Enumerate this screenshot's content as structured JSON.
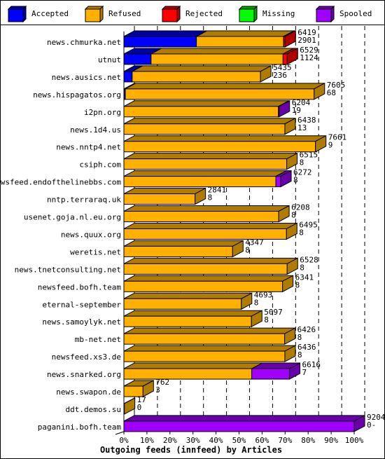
{
  "chart_data": {
    "type": "bar",
    "orientation": "horizontal",
    "stacked": true,
    "style": "3d",
    "title": "Outgoing feeds (innfeed) by Articles",
    "xlabel": "Outgoing feeds (innfeed) by Articles",
    "ylabel": "",
    "xlim": [
      0,
      100
    ],
    "x_ticks": [
      "0%",
      "10%",
      "20%",
      "30%",
      "40%",
      "50%",
      "60%",
      "70%",
      "80%",
      "90%",
      "100%"
    ],
    "grid": true,
    "legend_position": "top",
    "legend": [
      {
        "name": "Accepted",
        "color": "#0000ff",
        "side": "#0000a0"
      },
      {
        "name": "Refused",
        "color": "#ffb000",
        "side": "#b07c00"
      },
      {
        "name": "Rejected",
        "color": "#ff0000",
        "side": "#b00000"
      },
      {
        "name": "Missing",
        "color": "#00ff00",
        "side": "#00a000"
      },
      {
        "name": "Spooled",
        "color": "#a000ff",
        "side": "#6a00aa"
      }
    ],
    "categories": [
      "news.chmurka.net",
      "utnut",
      "news.ausics.net",
      "news.hispagatos.org",
      "i2pn.org",
      "news.1d4.us",
      "news.nntp4.net",
      "csiph.com",
      "newsfeed.endofthelinebbs.com",
      "nntp.terraraq.uk",
      "usenet.goja.nl.eu.org",
      "news.quux.org",
      "weretis.net",
      "news.tnetconsulting.net",
      "newsfeed.bofh.team",
      "eternal-september",
      "news.samoylyk.net",
      "mb-net.net",
      "newsfeed.xs3.de",
      "news.snarked.org",
      "news.swapon.de",
      "ddt.demos.su",
      "paganini.bofh.team"
    ],
    "series": [
      {
        "name": "Accepted",
        "values": [
          31.5,
          11.8,
          3.6,
          0.6,
          0,
          0,
          0,
          0,
          0,
          0,
          0,
          0,
          0,
          0,
          0,
          0,
          0,
          0,
          0,
          0,
          0,
          0,
          0
        ]
      },
      {
        "name": "Refused",
        "values": [
          37.8,
          57.3,
          55.7,
          82.0,
          67.1,
          69.9,
          83.2,
          70.7,
          66.0,
          30.9,
          67.2,
          70.6,
          47.2,
          70.9,
          68.9,
          51.0,
          55.4,
          69.8,
          69.9,
          55.5,
          8.3,
          0.2,
          0
        ]
      },
      {
        "name": "Rejected",
        "values": [
          0.7,
          1.8,
          0,
          0,
          0,
          0,
          0,
          0,
          0,
          0,
          0,
          0,
          0,
          0,
          0,
          0,
          0,
          0,
          0,
          0,
          0,
          0,
          0
        ]
      },
      {
        "name": "Missing",
        "values": [
          0,
          0,
          0,
          0,
          0,
          0,
          0,
          0,
          0,
          0,
          0,
          0,
          0,
          0,
          0,
          0,
          0,
          0,
          0,
          0,
          0,
          0,
          0
        ]
      },
      {
        "name": "Spooled",
        "values": [
          0,
          0,
          0,
          0,
          0.3,
          0,
          0,
          0,
          2.1,
          0,
          0,
          0,
          0,
          0,
          0,
          0,
          0,
          0,
          0,
          16.4,
          0,
          0,
          100
        ]
      }
    ],
    "annotations": [
      {
        "category": "news.chmurka.net",
        "total": "6419",
        "second": "2901"
      },
      {
        "category": "utnut",
        "total": "6529",
        "second": "1124"
      },
      {
        "category": "news.ausics.net",
        "total": "5435",
        "second": "236"
      },
      {
        "category": "news.hispagatos.org",
        "total": "7605",
        "second": "68"
      },
      {
        "category": "i2pn.org",
        "total": "6204",
        "second": "19"
      },
      {
        "category": "news.1d4.us",
        "total": "6438",
        "second": "13"
      },
      {
        "category": "news.nntp4.net",
        "total": "7661",
        "second": "9"
      },
      {
        "category": "csiph.com",
        "total": "6515",
        "second": "8"
      },
      {
        "category": "newsfeed.endofthelinebbs.com",
        "total": "6272",
        "second": "8"
      },
      {
        "category": "nntp.terraraq.uk",
        "total": "2841",
        "second": "8"
      },
      {
        "category": "usenet.goja.nl.eu.org",
        "total": "6208",
        "second": "8"
      },
      {
        "category": "news.quux.org",
        "total": "6495",
        "second": "8"
      },
      {
        "category": "weretis.net",
        "total": "4347",
        "second": "8"
      },
      {
        "category": "news.tnetconsulting.net",
        "total": "6528",
        "second": "8"
      },
      {
        "category": "newsfeed.bofh.team",
        "total": "6341",
        "second": "8"
      },
      {
        "category": "eternal-september",
        "total": "4693",
        "second": "8"
      },
      {
        "category": "news.samoylyk.net",
        "total": "5097",
        "second": "8"
      },
      {
        "category": "mb-net.net",
        "total": "6426",
        "second": "8"
      },
      {
        "category": "newsfeed.xs3.de",
        "total": "6436",
        "second": "8"
      },
      {
        "category": "news.snarked.org",
        "total": "6616",
        "second": "7"
      },
      {
        "category": "news.swapon.de",
        "total": "762",
        "second": "3"
      },
      {
        "category": "ddt.demos.su",
        "total": "17",
        "second": "0"
      },
      {
        "category": "paganini.bofh.team",
        "total": "9204",
        "second": "0-"
      }
    ]
  }
}
